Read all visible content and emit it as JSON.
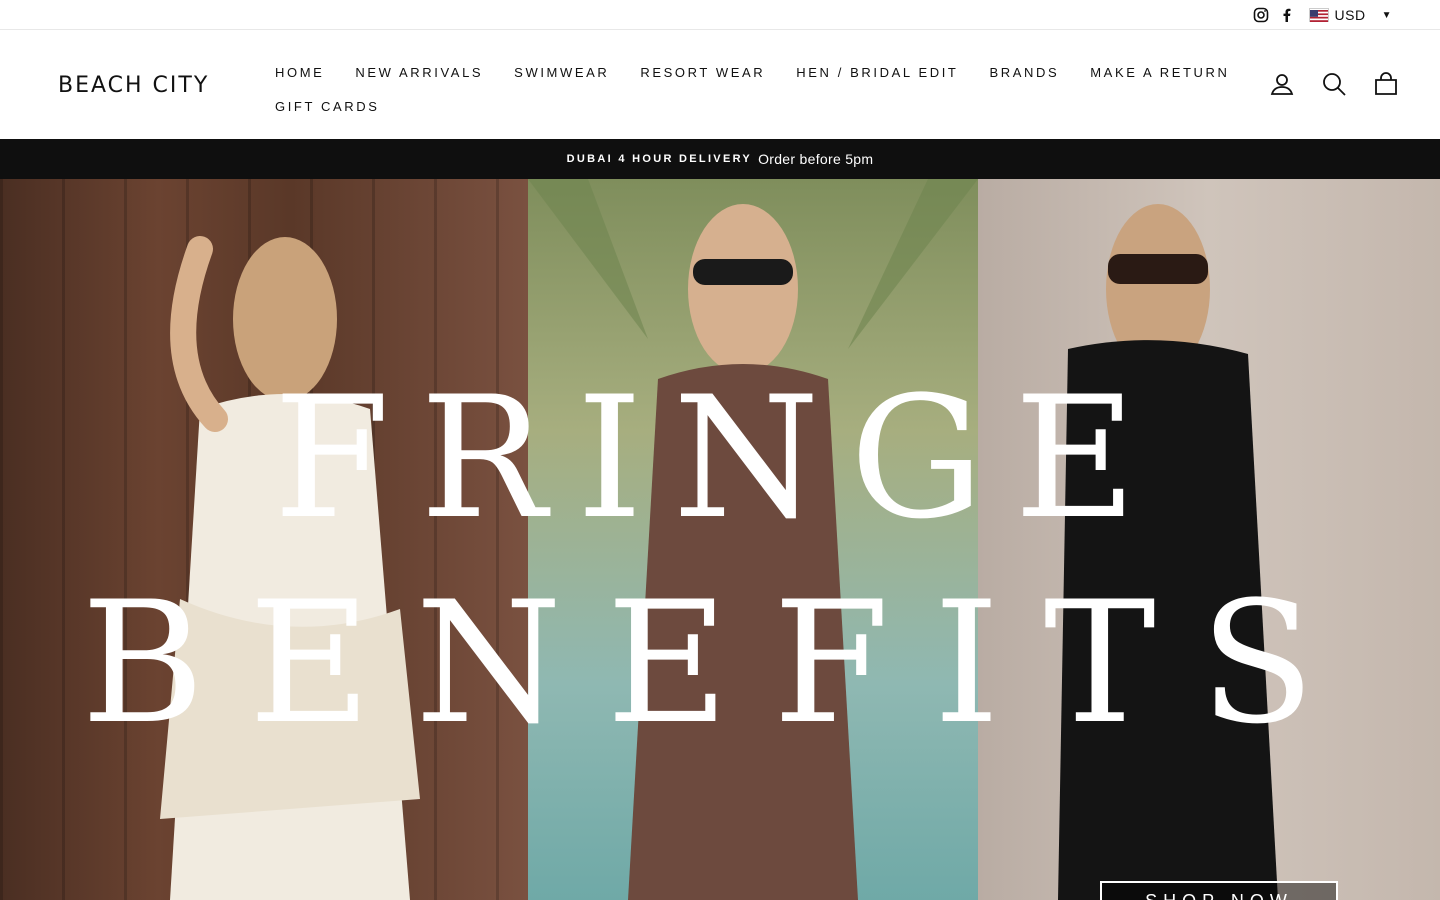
{
  "utility": {
    "currency_code": "USD"
  },
  "brand": {
    "logo_text": "BEACH CITY"
  },
  "nav": {
    "items": [
      {
        "label": "HOME"
      },
      {
        "label": "NEW ARRIVALS"
      },
      {
        "label": "SWIMWEAR"
      },
      {
        "label": "RESORT WEAR"
      },
      {
        "label": "HEN / BRIDAL EDIT"
      },
      {
        "label": "BRANDS"
      },
      {
        "label": "MAKE A RETURN"
      },
      {
        "label": "GIFT CARDS"
      }
    ]
  },
  "header_actions": {
    "login_label": "LOG IN",
    "search_label": "SEARCH",
    "cart_label": "CART"
  },
  "announcement": {
    "strong": "DUBAI 4 HOUR DELIVERY",
    "text": "Order before 5pm"
  },
  "hero": {
    "line1": "FRINGE",
    "line2": "BENEFITS",
    "cta_label": "SHOP NOW"
  },
  "colors": {
    "announcement_bg": "#0f0f0f",
    "text": "#111111",
    "hero_text": "#ffffff"
  }
}
